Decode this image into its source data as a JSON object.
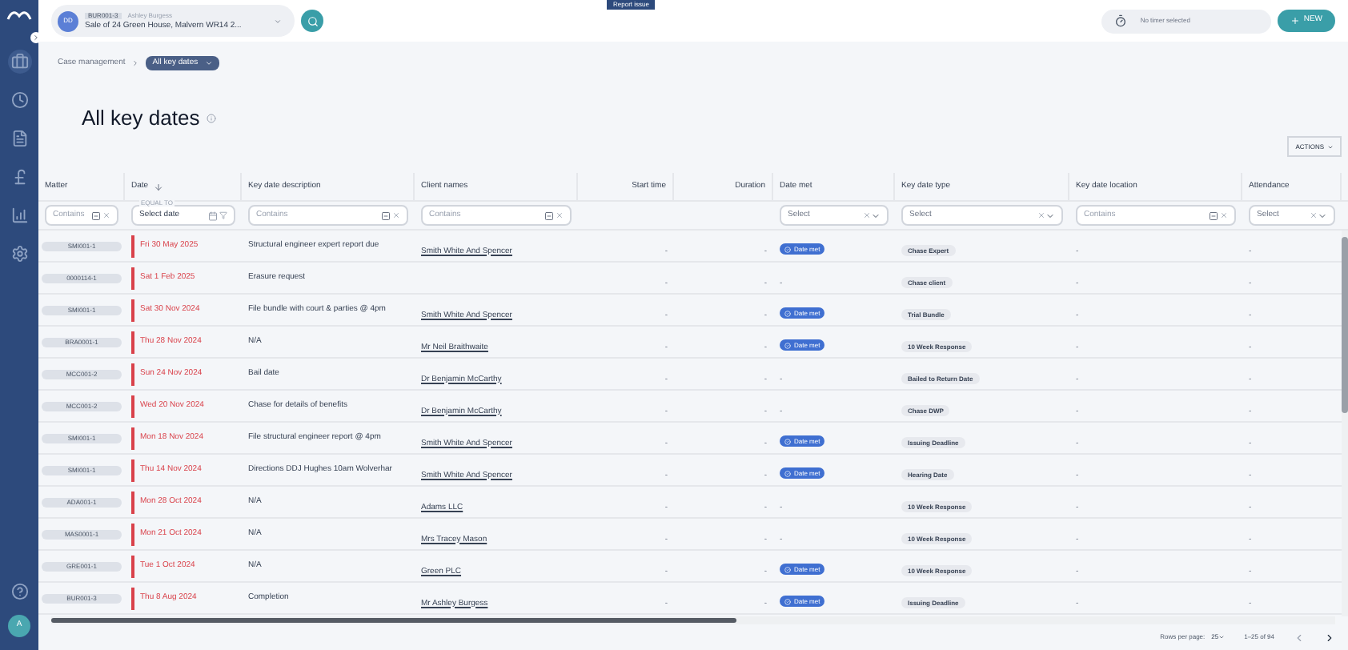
{
  "topbar": {
    "matter_avatar": "DD",
    "matter_ref": "BUR001-3",
    "matter_client": "Ashley Burgess",
    "matter_title": "Sale of 24 Green House, Malvern WR14 2...",
    "report_issue": "Report issue",
    "timer": "No timer selected",
    "new_button": "NEW"
  },
  "breadcrumb": {
    "parent": "Case management",
    "current": "All key dates"
  },
  "page_title": "All key dates",
  "actions_button": "ACTIONS",
  "columns": [
    {
      "label": "Matter",
      "filter": {
        "kind": "text",
        "placeholder": "Contains"
      }
    },
    {
      "label": "Date",
      "sorted": true,
      "filter": {
        "kind": "date",
        "caption": "EQUAL TO",
        "placeholder": "Select date"
      }
    },
    {
      "label": "Key date description",
      "filter": {
        "kind": "text",
        "placeholder": "Contains"
      }
    },
    {
      "label": "Client names",
      "filter": {
        "kind": "text",
        "placeholder": "Contains"
      }
    },
    {
      "label": "Start time"
    },
    {
      "label": "Duration"
    },
    {
      "label": "Date met",
      "filter": {
        "kind": "select",
        "placeholder": "Select"
      }
    },
    {
      "label": "Key date type",
      "filter": {
        "kind": "select",
        "placeholder": "Select"
      }
    },
    {
      "label": "Key date location",
      "filter": {
        "kind": "text",
        "placeholder": "Contains"
      }
    },
    {
      "label": "Attendance",
      "filter": {
        "kind": "select",
        "placeholder": "Select"
      }
    }
  ],
  "rows": [
    {
      "matter": "SMI001-1",
      "date": "Fri 30 May 2025",
      "description": "Structural engineer expert report due",
      "client": "Smith White And Spencer",
      "start_time": "-",
      "duration": "-",
      "date_met": true,
      "date_met_label": "Date met",
      "type": "Chase Expert",
      "location": "-",
      "attendance": "-"
    },
    {
      "matter": "0000114-1",
      "date": "Sat 1 Feb 2025",
      "description": "Erasure request",
      "start_time": "-",
      "duration": "-",
      "date_met": false,
      "date_met_label": "-",
      "type": "Chase client",
      "location": "-",
      "attendance": "-"
    },
    {
      "matter": "SMI001-1",
      "date": "Sat 30 Nov 2024",
      "description": "File bundle with court & parties @ 4pm",
      "client": "Smith White And Spencer",
      "start_time": "-",
      "duration": "-",
      "date_met": true,
      "date_met_label": "Date met",
      "type": "Trial Bundle",
      "location": "-",
      "attendance": "-"
    },
    {
      "matter": "BRA0001-1",
      "date": "Thu 28 Nov 2024",
      "description": "N/A",
      "client": "Mr Neil Braithwaite",
      "start_time": "-",
      "duration": "-",
      "date_met": true,
      "date_met_label": "Date met",
      "type": "10 Week Response",
      "location": "-",
      "attendance": "-"
    },
    {
      "matter": "MCC001-2",
      "date": "Sun 24 Nov 2024",
      "description": "Bail date",
      "client": "Dr Benjamin McCarthy",
      "start_time": "-",
      "duration": "-",
      "date_met": false,
      "date_met_label": "-",
      "type": "Bailed to Return Date",
      "location": "-",
      "attendance": "-"
    },
    {
      "matter": "MCC001-2",
      "date": "Wed 20 Nov 2024",
      "description": "Chase for details of benefits",
      "client": "Dr Benjamin McCarthy",
      "start_time": "-",
      "duration": "-",
      "date_met": false,
      "date_met_label": "-",
      "type": "Chase DWP",
      "location": "-",
      "attendance": "-"
    },
    {
      "matter": "SMI001-1",
      "date": "Mon 18 Nov 2024",
      "description": "File structural engineer report @ 4pm",
      "client": "Smith White And Spencer",
      "start_time": "-",
      "duration": "-",
      "date_met": true,
      "date_met_label": "Date met",
      "type": "Issuing Deadline",
      "location": "-",
      "attendance": "-"
    },
    {
      "matter": "SMI001-1",
      "date": "Thu 14 Nov 2024",
      "description": "Directions DDJ Hughes 10am Wolverhar",
      "client": "Smith White And Spencer",
      "start_time": "-",
      "duration": "-",
      "date_met": true,
      "date_met_label": "Date met",
      "type": "Hearing Date",
      "location": "-",
      "attendance": "-"
    },
    {
      "matter": "ADA001-1",
      "date": "Mon 28 Oct 2024",
      "description": "N/A",
      "client": "Adams LLC",
      "start_time": "-",
      "duration": "-",
      "date_met": false,
      "date_met_label": "-",
      "type": "10 Week Response",
      "location": "-",
      "attendance": "-"
    },
    {
      "matter": "MAS0001-1",
      "date": "Mon 21 Oct 2024",
      "description": "N/A",
      "client": "Mrs Tracey Mason",
      "start_time": "-",
      "duration": "-",
      "date_met": false,
      "date_met_label": "-",
      "type": "10 Week Response",
      "location": "-",
      "attendance": "-"
    },
    {
      "matter": "GRE001-1",
      "date": "Tue 1 Oct 2024",
      "description": "N/A",
      "client": "Green PLC",
      "start_time": "-",
      "duration": "-",
      "date_met": true,
      "date_met_label": "Date met",
      "type": "10 Week Response",
      "location": "-",
      "attendance": "-"
    },
    {
      "matter": "BUR001-3",
      "date": "Thu 8 Aug 2024",
      "description": "Completion",
      "client": "Mr Ashley Burgess",
      "start_time": "-",
      "duration": "-",
      "date_met": true,
      "date_met_label": "Date met",
      "type": "Issuing Deadline",
      "location": "-",
      "attendance": "-"
    }
  ],
  "footer": {
    "rows_per_page_label": "Rows per page:",
    "rows_per_page": "25",
    "range": "1–25 of 94"
  },
  "sidebar": {
    "user_avatar": "A"
  }
}
